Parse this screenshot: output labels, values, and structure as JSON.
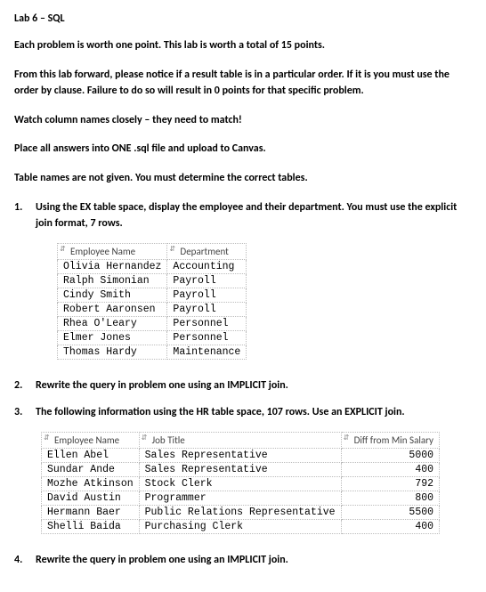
{
  "title": "Lab 6 – SQL",
  "paragraphs": [
    "Each problem is worth one point. This lab is worth a total of 15 points.",
    "From this lab forward, please notice if a result table is in a particular order. If it is you must use the order by clause. Failure to do so will result in 0 points for that specific problem.",
    "Watch column names closely – they need to match!",
    "Place all answers into ONE .sql file and upload to Canvas.",
    "Table names are not given. You must determine the correct tables."
  ],
  "q1": {
    "num": "1.",
    "text": "Using the EX table space, display the employee and their department. You must use the explicit join format, 7 rows.",
    "headers": {
      "c1": "Employee Name",
      "c2": "Department"
    },
    "rows": [
      {
        "c1": "Olivia Hernandez",
        "c2": "Accounting"
      },
      {
        "c1": "Ralph Simonian",
        "c2": "Payroll"
      },
      {
        "c1": "Cindy Smith",
        "c2": "Payroll"
      },
      {
        "c1": "Robert Aaronsen",
        "c2": "Payroll"
      },
      {
        "c1": "Rhea O'Leary",
        "c2": "Personnel"
      },
      {
        "c1": "Elmer Jones",
        "c2": "Personnel"
      },
      {
        "c1": "Thomas Hardy",
        "c2": "Maintenance"
      }
    ]
  },
  "q2": {
    "num": "2.",
    "text": "Rewrite the query in problem one using an IMPLICIT join."
  },
  "q3": {
    "num": "3.",
    "text": "The following information using the HR table space, 107 rows. Use an EXPLICIT join.",
    "headers": {
      "c1": "Employee Name",
      "c2": "Job Title",
      "c3": "Diff from Min Salary"
    },
    "rows": [
      {
        "c1": "Ellen Abel",
        "c2": "Sales Representative",
        "c3": "5000"
      },
      {
        "c1": "Sundar Ande",
        "c2": "Sales Representative",
        "c3": "400"
      },
      {
        "c1": "Mozhe Atkinson",
        "c2": "Stock Clerk",
        "c3": "792"
      },
      {
        "c1": "David Austin",
        "c2": "Programmer",
        "c3": "800"
      },
      {
        "c1": "Hermann Baer",
        "c2": "Public Relations Representative",
        "c3": "5500"
      },
      {
        "c1": "Shelli Baida",
        "c2": "Purchasing Clerk",
        "c3": "400"
      }
    ]
  },
  "q4": {
    "num": "4.",
    "text": "Rewrite the query in problem one using an IMPLICIT join."
  }
}
